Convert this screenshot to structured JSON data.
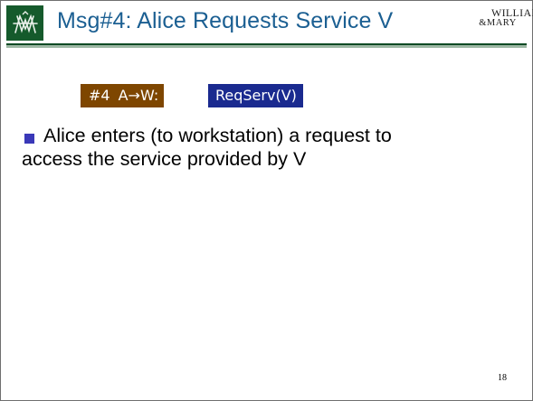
{
  "title": "Msg#4: Alice Requests Service V",
  "watermark": {
    "line1": "WILLIAM",
    "line2": "&MARY"
  },
  "message": {
    "number": "#4",
    "flow": "A→W:",
    "content": "ReqServ(V)"
  },
  "bullet": {
    "line1": "Alice enters (to workstation) a request to",
    "line2": "access the service provided by V"
  },
  "page_number": "18",
  "logo_icon": "wm-cypher-icon",
  "colors": {
    "title": "#1b5f92",
    "logo_bg": "#155a2c",
    "message_left_bg": "#7e4600",
    "message_right_bg": "#1a2a8f",
    "bullet": "#3a38b8",
    "rule": "#0d4a24"
  }
}
